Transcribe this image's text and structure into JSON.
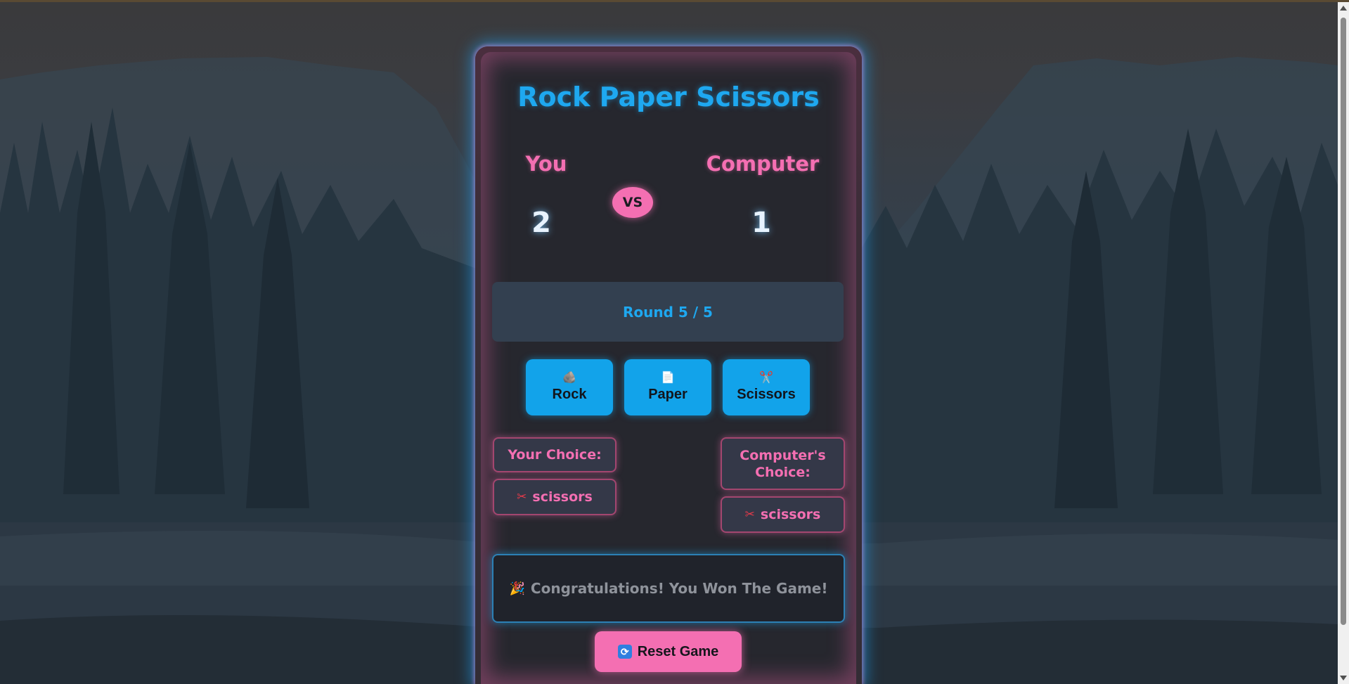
{
  "game": {
    "title": "Rock Paper Scissors",
    "players": {
      "you_label": "You",
      "computer_label": "Computer",
      "you_score": "2",
      "computer_score": "1",
      "vs_label": "VS"
    },
    "round_text": "Round 5 / 5",
    "choices": [
      {
        "label": "Rock",
        "icon": "rock-icon",
        "glyph": "🪨"
      },
      {
        "label": "Paper",
        "icon": "paper-icon",
        "glyph": "📄"
      },
      {
        "label": "Scissors",
        "icon": "scissors-icon",
        "glyph": "✂️"
      }
    ],
    "your_choice_label": "Your Choice:",
    "your_choice_value": "scissors",
    "computer_choice_label": "Computer's Choice:",
    "computer_choice_value": "scissors",
    "result_text": "Congratulations! You Won The Game!",
    "reset_label": "Reset Game"
  },
  "colors": {
    "accent_blue": "#1ea8f0",
    "accent_pink": "#f46fb2",
    "card_background": "#26272e"
  }
}
